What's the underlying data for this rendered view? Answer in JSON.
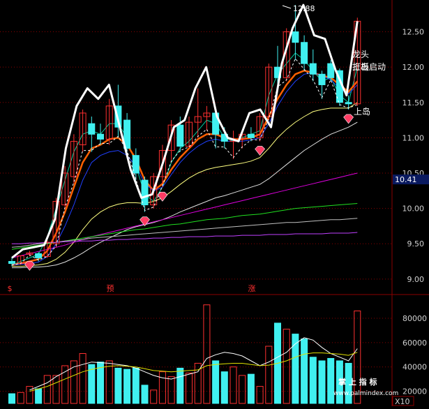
{
  "colors": {
    "background": "#000000",
    "grid": "#8b0000",
    "up_candle": "#ff3030",
    "down_candle": "#40f0f0",
    "axis_text": "#d0d0d0",
    "current_price_bg": "#0a1a60",
    "signal_text": "#ff3030",
    "annotation_text": "#ffffff",
    "diamond": "#ff3c64",
    "zigzag": "#ffffff",
    "ma_fast": "#00d0a0",
    "ma_orange": "#ff6000",
    "ma_blue": "#2040ff",
    "ma_yellow": "#ffff80",
    "ma_white": "#e0e0e0",
    "ma_magenta": "#e000e0",
    "ma_green": "#20e020",
    "ma_grey": "#c0c0c0",
    "ma_violet": "#c040ff",
    "vol_ma_white": "#ffffff",
    "vol_ma_yellow": "#e0e000"
  },
  "chart_data": [
    {
      "type": "candlestick",
      "name": "price",
      "ylim": [
        8.85,
        12.95
      ],
      "y_ticks": [
        "9.00",
        "9.50",
        "10.00",
        "10.50",
        "11.00",
        "11.50",
        "12.00",
        "12.50"
      ],
      "current_price": "10.41",
      "high_label": "12.88",
      "annotations": [
        "龙头",
        "打板启动",
        "上岛",
        "上岛"
      ],
      "bottom_signals": [
        "$",
        "预",
        "涨"
      ],
      "candles": [
        {
          "o": 9.25,
          "h": 9.3,
          "l": 9.18,
          "c": 9.22
        },
        {
          "o": 9.22,
          "h": 9.33,
          "l": 9.2,
          "c": 9.33
        },
        {
          "o": 9.35,
          "h": 9.4,
          "l": 9.32,
          "c": 9.37
        },
        {
          "o": 9.36,
          "h": 9.38,
          "l": 9.25,
          "c": 9.3
        },
        {
          "o": 9.32,
          "h": 9.55,
          "l": 9.3,
          "c": 9.52
        },
        {
          "o": 9.5,
          "h": 10.15,
          "l": 9.45,
          "c": 10.1
        },
        {
          "o": 10.05,
          "h": 10.6,
          "l": 10.0,
          "c": 10.5
        },
        {
          "o": 10.45,
          "h": 11.05,
          "l": 10.35,
          "c": 10.95
        },
        {
          "o": 10.9,
          "h": 11.4,
          "l": 10.8,
          "c": 11.35
        },
        {
          "o": 11.2,
          "h": 11.3,
          "l": 10.8,
          "c": 11.05
        },
        {
          "o": 11.05,
          "h": 11.2,
          "l": 10.9,
          "c": 10.98
        },
        {
          "o": 10.98,
          "h": 11.55,
          "l": 10.9,
          "c": 11.45
        },
        {
          "o": 11.45,
          "h": 11.75,
          "l": 11.0,
          "c": 11.15
        },
        {
          "o": 11.25,
          "h": 11.35,
          "l": 10.8,
          "c": 10.85
        },
        {
          "o": 10.75,
          "h": 10.85,
          "l": 10.4,
          "c": 10.5
        },
        {
          "o": 10.4,
          "h": 10.45,
          "l": 9.95,
          "c": 10.05
        },
        {
          "o": 10.05,
          "h": 10.5,
          "l": 10.0,
          "c": 10.45
        },
        {
          "o": 10.45,
          "h": 10.9,
          "l": 10.3,
          "c": 10.82
        },
        {
          "o": 10.82,
          "h": 11.25,
          "l": 10.65,
          "c": 11.18
        },
        {
          "o": 11.18,
          "h": 11.3,
          "l": 10.8,
          "c": 10.88
        },
        {
          "o": 10.88,
          "h": 11.3,
          "l": 10.85,
          "c": 11.22
        },
        {
          "o": 11.22,
          "h": 11.7,
          "l": 11.0,
          "c": 11.3
        },
        {
          "o": 11.3,
          "h": 11.45,
          "l": 11.1,
          "c": 11.35
        },
        {
          "o": 11.35,
          "h": 11.4,
          "l": 10.85,
          "c": 11.05
        },
        {
          "o": 11.05,
          "h": 11.15,
          "l": 10.85,
          "c": 10.95
        },
        {
          "o": 10.95,
          "h": 11.1,
          "l": 10.7,
          "c": 10.98
        },
        {
          "o": 10.98,
          "h": 11.1,
          "l": 10.85,
          "c": 11.05
        },
        {
          "o": 11.05,
          "h": 11.15,
          "l": 10.95,
          "c": 11.0
        },
        {
          "o": 11.0,
          "h": 11.35,
          "l": 10.95,
          "c": 11.3
        },
        {
          "o": 11.3,
          "h": 12.05,
          "l": 11.25,
          "c": 12.0
        },
        {
          "o": 12.0,
          "h": 12.3,
          "l": 11.7,
          "c": 11.85
        },
        {
          "o": 11.85,
          "h": 12.55,
          "l": 11.8,
          "c": 12.5
        },
        {
          "o": 12.5,
          "h": 12.88,
          "l": 12.1,
          "c": 12.35
        },
        {
          "o": 12.35,
          "h": 12.45,
          "l": 11.95,
          "c": 12.05
        },
        {
          "o": 12.05,
          "h": 12.25,
          "l": 11.8,
          "c": 11.9
        },
        {
          "o": 11.9,
          "h": 11.95,
          "l": 11.55,
          "c": 11.75
        },
        {
          "o": 12.05,
          "h": 12.1,
          "l": 11.8,
          "c": 11.85
        },
        {
          "o": 11.95,
          "h": 11.98,
          "l": 11.45,
          "c": 11.5
        },
        {
          "o": 11.5,
          "h": 11.6,
          "l": 11.4,
          "c": 11.48
        },
        {
          "o": 11.48,
          "h": 12.7,
          "l": 11.45,
          "c": 12.65
        }
      ],
      "zigzag": [
        9.3,
        9.42,
        9.45,
        9.48,
        9.85,
        10.85,
        11.45,
        11.7,
        11.55,
        11.75,
        11.15,
        10.55,
        10.15,
        10.2,
        10.65,
        11.15,
        11.25,
        11.7,
        12.0,
        11.3,
        11.0,
        10.95,
        11.35,
        11.4,
        11.15,
        12.05,
        12.55,
        12.88,
        12.45,
        12.4,
        11.95,
        11.6,
        12.65
      ],
      "series": [
        {
          "key": "ma_fast",
          "width": 1,
          "values": [
            9.2,
            9.25,
            9.3,
            9.35,
            9.6,
            10.0,
            10.4,
            10.8,
            11.05,
            11.1,
            11.05,
            11.2,
            11.2,
            11.0,
            10.6,
            10.2,
            10.1,
            10.3,
            10.65,
            10.85,
            10.95,
            11.1,
            11.25,
            11.2,
            11.0,
            10.95,
            11.0,
            11.05,
            11.1,
            11.6,
            11.9,
            12.05,
            12.2,
            12.1,
            11.95,
            11.8,
            11.85,
            11.6,
            11.5,
            12.0
          ]
        },
        {
          "key": "ma_orange",
          "width": 2.5,
          "values": [
            9.2,
            9.22,
            9.25,
            9.28,
            9.4,
            9.65,
            9.95,
            10.3,
            10.65,
            10.85,
            10.9,
            10.98,
            11.0,
            10.9,
            10.7,
            10.4,
            10.25,
            10.35,
            10.55,
            10.72,
            10.85,
            10.98,
            11.05,
            11.05,
            11.0,
            10.98,
            10.98,
            11.0,
            11.05,
            11.3,
            11.55,
            11.75,
            11.9,
            11.95,
            11.92,
            11.88,
            11.85,
            11.75,
            11.65,
            11.8
          ]
        },
        {
          "key": "ma_blue",
          "width": 1,
          "values": [
            9.2,
            9.21,
            9.22,
            9.24,
            9.32,
            9.5,
            9.75,
            10.05,
            10.4,
            10.65,
            10.75,
            10.8,
            10.82,
            10.75,
            10.6,
            10.35,
            10.25,
            10.3,
            10.48,
            10.65,
            10.78,
            10.88,
            10.95,
            10.98,
            10.95,
            10.95,
            10.95,
            10.97,
            11.0,
            11.2,
            11.45,
            11.65,
            11.8,
            11.9,
            11.92,
            11.88,
            11.82,
            11.7,
            11.62,
            11.75
          ]
        },
        {
          "key": "ma_yellow",
          "width": 1,
          "values": [
            9.18,
            9.18,
            9.19,
            9.2,
            9.22,
            9.28,
            9.38,
            9.52,
            9.7,
            9.85,
            9.95,
            10.02,
            10.06,
            10.08,
            10.08,
            10.07,
            10.1,
            10.15,
            10.24,
            10.34,
            10.43,
            10.5,
            10.55,
            10.58,
            10.6,
            10.62,
            10.64,
            10.67,
            10.72,
            10.85,
            11.0,
            11.12,
            11.22,
            11.3,
            11.37,
            11.4,
            11.42,
            11.42,
            11.42,
            11.5
          ]
        },
        {
          "key": "ma_white",
          "width": 1,
          "values": [
            9.16,
            9.16,
            9.17,
            9.17,
            9.18,
            9.2,
            9.24,
            9.3,
            9.37,
            9.45,
            9.52,
            9.58,
            9.64,
            9.7,
            9.74,
            9.77,
            9.8,
            9.84,
            9.89,
            9.95,
            10.0,
            10.05,
            10.1,
            10.15,
            10.18,
            10.22,
            10.26,
            10.3,
            10.34,
            10.42,
            10.52,
            10.62,
            10.72,
            10.82,
            10.9,
            10.98,
            11.05,
            11.1,
            11.15,
            11.22
          ]
        },
        {
          "key": "ma_magenta",
          "width": 1,
          "values": [
            9.3,
            9.33,
            9.36,
            9.39,
            9.42,
            9.45,
            9.48,
            9.52,
            9.56,
            9.6,
            9.63,
            9.66,
            9.69,
            9.72,
            9.75,
            9.78,
            9.81,
            9.84,
            9.87,
            9.9,
            9.93,
            9.96,
            9.99,
            10.02,
            10.05,
            10.08,
            10.11,
            10.14,
            10.17,
            10.2,
            10.23,
            10.26,
            10.29,
            10.32,
            10.35,
            10.38,
            10.41,
            10.44,
            10.47,
            10.5
          ]
        },
        {
          "key": "ma_green",
          "width": 1,
          "values": [
            9.42,
            9.44,
            9.46,
            9.48,
            9.5,
            9.52,
            9.54,
            9.56,
            9.58,
            9.6,
            9.62,
            9.64,
            9.66,
            9.68,
            9.7,
            9.71,
            9.73,
            9.75,
            9.77,
            9.78,
            9.8,
            9.82,
            9.84,
            9.85,
            9.86,
            9.88,
            9.9,
            9.91,
            9.92,
            9.94,
            9.96,
            9.98,
            10.0,
            10.01,
            10.02,
            10.03,
            10.04,
            10.05,
            10.06,
            10.07
          ]
        },
        {
          "key": "ma_grey",
          "width": 1,
          "values": [
            9.45,
            9.46,
            9.48,
            9.5,
            9.51,
            9.52,
            9.54,
            9.55,
            9.56,
            9.58,
            9.59,
            9.6,
            9.61,
            9.62,
            9.63,
            9.64,
            9.65,
            9.66,
            9.67,
            9.68,
            9.69,
            9.7,
            9.71,
            9.72,
            9.73,
            9.74,
            9.75,
            9.76,
            9.77,
            9.78,
            9.79,
            9.8,
            9.8,
            9.81,
            9.82,
            9.83,
            9.84,
            9.84,
            9.85,
            9.86
          ]
        },
        {
          "key": "ma_violet",
          "width": 1,
          "values": [
            9.5,
            9.5,
            9.51,
            9.51,
            9.52,
            9.52,
            9.53,
            9.53,
            9.54,
            9.54,
            9.55,
            9.55,
            9.56,
            9.56,
            9.57,
            9.57,
            9.58,
            9.58,
            9.59,
            9.59,
            9.6,
            9.6,
            9.6,
            9.61,
            9.61,
            9.61,
            9.62,
            9.62,
            9.62,
            9.63,
            9.63,
            9.63,
            9.64,
            9.64,
            9.64,
            9.64,
            9.65,
            9.65,
            9.65,
            9.66
          ]
        }
      ]
    },
    {
      "type": "bar",
      "name": "volume",
      "ylim": [
        10000,
        90000
      ],
      "y_ticks": [
        "20000",
        "40000",
        "60000",
        "80000"
      ],
      "unit_label": "X10",
      "watermark": "掌 上 指 标",
      "watermark_url": "www.palmindex.com",
      "values": [
        18000,
        19000,
        24000,
        22000,
        33000,
        33000,
        41000,
        45000,
        51000,
        42000,
        44000,
        45000,
        39000,
        38000,
        39000,
        25000,
        21000,
        36000,
        32000,
        39000,
        35000,
        43000,
        91000,
        45000,
        36000,
        40000,
        33000,
        34000,
        24000,
        57000,
        76000,
        71000,
        67000,
        63000,
        48000,
        45000,
        47000,
        45000,
        43000,
        86000
      ],
      "ma_white": [
        null,
        null,
        21000,
        24000,
        27000,
        32000,
        36000,
        40000,
        42000,
        44000,
        43500,
        43000,
        42000,
        41000,
        39000,
        36000,
        33000,
        31000,
        30000,
        32000,
        34000,
        36000,
        47000,
        50000,
        52000,
        51000,
        49000,
        45000,
        41000,
        44000,
        48000,
        52000,
        59000,
        64000,
        62000,
        56000,
        51000,
        48000,
        45000,
        55000
      ],
      "ma_yellow": [
        null,
        null,
        20000,
        22000,
        24000,
        27000,
        30000,
        33000,
        36000,
        38000,
        39500,
        40500,
        41000,
        40500,
        40000,
        38500,
        37000,
        36500,
        36000,
        36500,
        37000,
        37500,
        41000,
        42000,
        42500,
        43000,
        43000,
        42000,
        41000,
        41500,
        43000,
        45000,
        48000,
        50500,
        51500,
        51500,
        51000,
        50500,
        49500,
        52000
      ]
    }
  ]
}
